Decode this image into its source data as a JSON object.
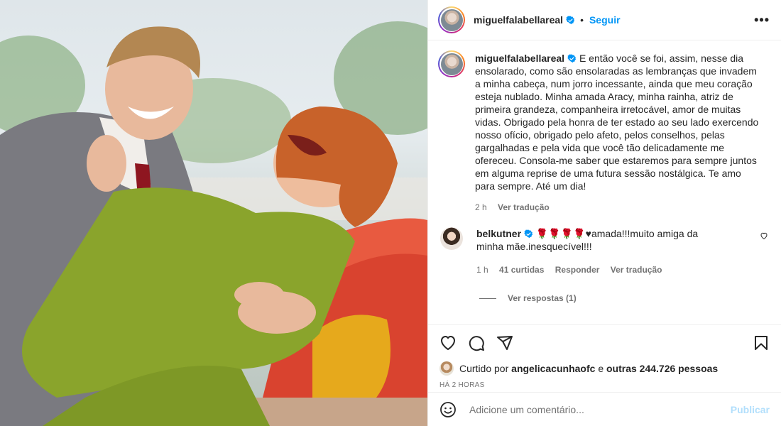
{
  "post": {
    "username": "miguelfalabellareal",
    "follow_label": "Seguir",
    "more_label": "•••",
    "caption_text": "E então você se foi, assim, nesse dia ensolarado, como são ensolaradas as lembranças que invadem a minha cabeça, num jorro incessante, ainda que meu coração esteja nublado. Minha amada Aracy, minha rainha, atriz de primeira grandeza, companheira irretocável, amor de muitas vidas. Obrigado pela honra de ter estado ao seu lado exercendo nosso ofício, obrigado pelo afeto, pelos conselhos, pelas gargalhadas e pela vida que você tão delicadamente me ofereceu. Consola-me saber que estaremos para sempre juntos em alguma reprise de uma futura sessão nostálgica. Te amo para sempre. Até um dia!",
    "caption_time": "2 h",
    "see_translation": "Ver tradução"
  },
  "comment": {
    "username": "belkutner",
    "roses": "🌹🌹🌹🌹",
    "text": "♥amada!!!muito amiga da minha mãe.inesquecível!!!",
    "time": "1 h",
    "likes": "41 curtidas",
    "reply": "Responder",
    "see_translation": "Ver tradução",
    "view_replies": "Ver respostas (1)"
  },
  "likes": {
    "prefix": "Curtido por",
    "user": "angelicacunhaofc",
    "and": "e",
    "others": "outras 244.726 pessoas",
    "posted_ago": "HÁ 2 HORAS"
  },
  "add_comment": {
    "placeholder": "Adicione um comentário...",
    "publish": "Publicar"
  },
  "colors": {
    "accent": "#0095f6",
    "publish_disabled": "#b2dffc",
    "muted": "#737373"
  },
  "icons": [
    "verified-icon",
    "more-icon",
    "heart-icon",
    "comment-icon",
    "share-icon",
    "bookmark-icon",
    "emoji-icon"
  ]
}
